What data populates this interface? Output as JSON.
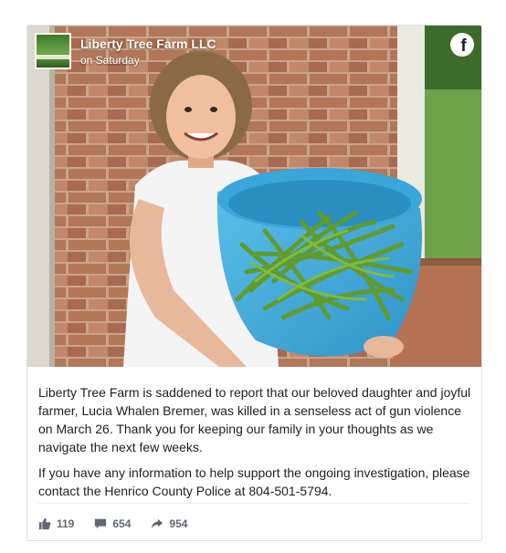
{
  "post": {
    "page_name": "Liberty Tree Farm LLC",
    "timestamp": "on Saturday",
    "paragraphs": [
      "Liberty Tree Farm is saddened to report that our beloved daughter and joyful farmer, Lucia Whalen Bremer, was killed in a senseless act of gun violence on March 26. Thank you for keeping our family in your thoughts as we navigate the next few weeks.",
      "If you have any information to help support the ongoing investigation, please contact the Henrico County Police at 804-501-5794."
    ]
  },
  "stats": {
    "likes": "119",
    "comments": "654",
    "shares": "954"
  },
  "icons": {
    "logo": "facebook-logo-icon",
    "likes": "thumbs-up-icon",
    "comments": "comment-icon",
    "shares": "share-arrow-icon"
  },
  "colors": {
    "text": "#1c1e21",
    "meta_text": "#606770",
    "border": "#dddfe2",
    "basket": "#46aee0"
  }
}
